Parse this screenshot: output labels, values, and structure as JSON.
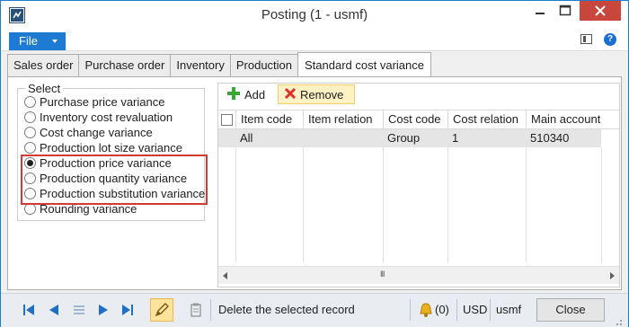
{
  "window": {
    "title": "Posting (1 - usmf)"
  },
  "menu": {
    "file_label": "File"
  },
  "tabs": [
    {
      "label": "Sales order"
    },
    {
      "label": "Purchase order"
    },
    {
      "label": "Inventory"
    },
    {
      "label": "Production"
    },
    {
      "label": "Standard cost variance",
      "active": true
    }
  ],
  "select_group": {
    "label": "Select",
    "options": [
      {
        "label": "Purchase price variance",
        "selected": false
      },
      {
        "label": "Inventory cost revaluation",
        "selected": false
      },
      {
        "label": "Cost change variance",
        "selected": false
      },
      {
        "label": "Production lot size variance",
        "selected": false
      },
      {
        "label": "Production price variance",
        "selected": true
      },
      {
        "label": "Production quantity variance",
        "selected": false
      },
      {
        "label": "Production substitution variance",
        "selected": false
      },
      {
        "label": "Rounding variance",
        "selected": false
      }
    ]
  },
  "grid_toolbar": {
    "add_label": "Add",
    "remove_label": "Remove"
  },
  "grid": {
    "columns": [
      "Item code",
      "Item relation",
      "Cost code",
      "Cost relation",
      "Main account"
    ],
    "rows": [
      [
        "All",
        "",
        "Group",
        "1",
        "510340"
      ]
    ]
  },
  "statusbar": {
    "message": "Delete the selected record",
    "notification_count": "(0)",
    "currency": "USD",
    "company": "usmf",
    "close_label": "Close"
  },
  "colors": {
    "accent": "#1e7bd3",
    "highlight_border": "#d33a36",
    "remove_bg": "#fff1c4",
    "close_button": "#c9463d"
  }
}
